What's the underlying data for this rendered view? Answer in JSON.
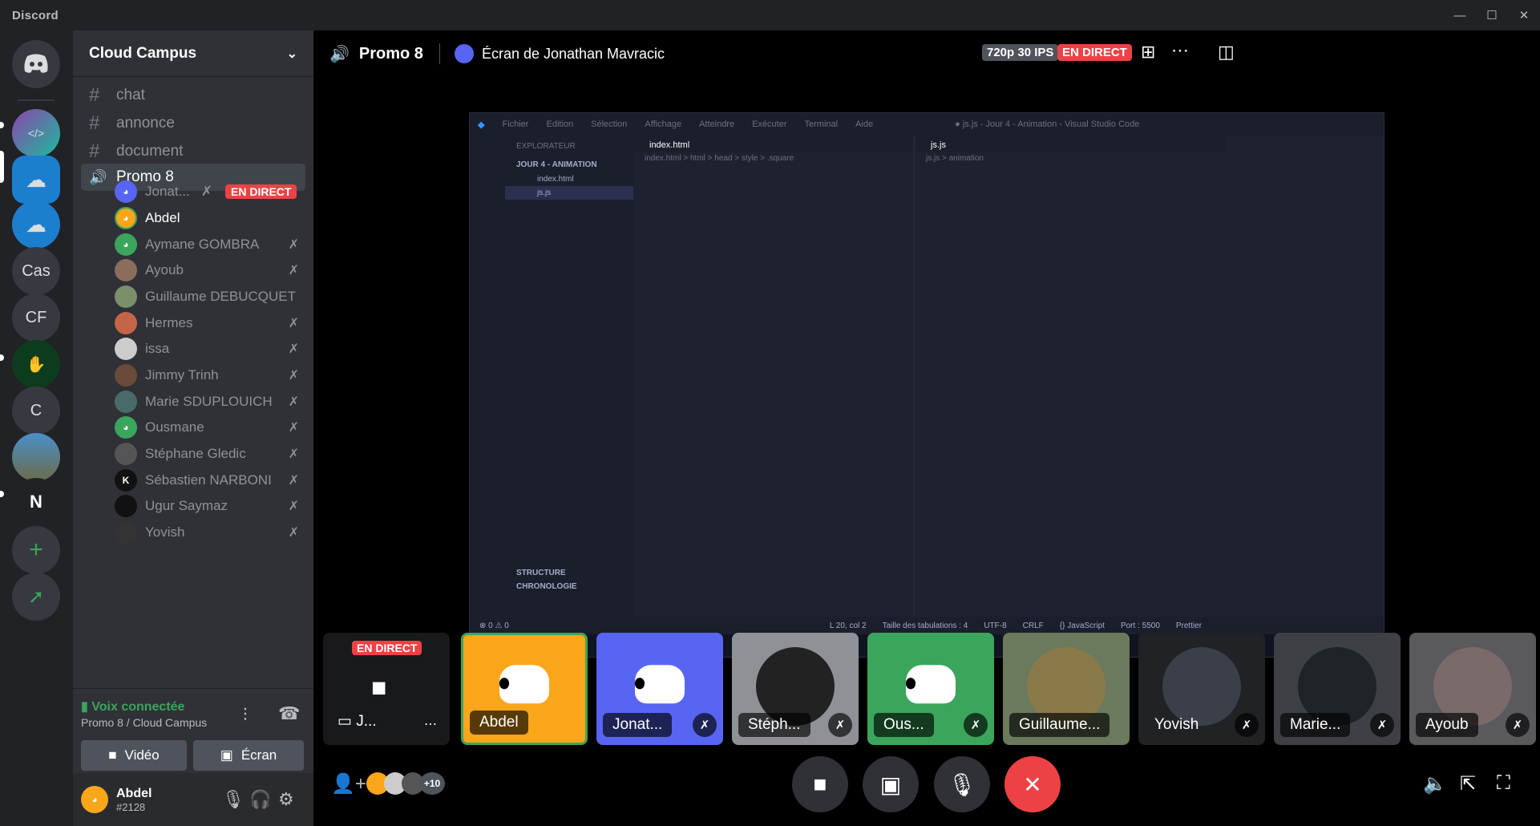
{
  "app": {
    "title": "Discord"
  },
  "colors": {
    "blurple": "#5865f2",
    "green": "#3ba55c",
    "red": "#ed4245",
    "orange": "#faa61a"
  },
  "servers": [
    {
      "label": "Cas"
    },
    {
      "label": "CF"
    },
    {
      "label": "C"
    }
  ],
  "guild": {
    "name": "Cloud Campus"
  },
  "channels": [
    {
      "name": "chat",
      "icon": "hash-icon"
    },
    {
      "name": "annonce",
      "icon": "hash-icon"
    },
    {
      "name": "document",
      "icon": "hash-icon"
    },
    {
      "name": "Promo 8",
      "icon": "speaker-icon"
    }
  ],
  "voice_users": [
    {
      "name": "Jonat...",
      "live": "EN DIRECT"
    },
    {
      "name": "Abdel"
    },
    {
      "name": "Aymane GOMBRA"
    },
    {
      "name": "Ayoub"
    },
    {
      "name": "Guillaume DEBUCQUET"
    },
    {
      "name": "Hermes"
    },
    {
      "name": "issa"
    },
    {
      "name": "Jimmy Trinh"
    },
    {
      "name": "Marie SDUPLOUICH"
    },
    {
      "name": "Ousmane"
    },
    {
      "name": "Stéphane Gledic"
    },
    {
      "name": "Sébastien NARBONI"
    },
    {
      "name": "Ugur Saymaz"
    },
    {
      "name": "Yovish"
    }
  ],
  "voice_panel": {
    "status": "Voix connectée",
    "location": "Promo 8 / Cloud Campus",
    "video": "Vidéo",
    "screen": "Écran"
  },
  "user_panel": {
    "name": "Abdel",
    "tag": "#2128"
  },
  "stream": {
    "channel": "Promo 8",
    "title": "Écran de Jonathan Mavracic",
    "quality": "720p 30 IPS",
    "live": "EN DIRECT"
  },
  "vscode": {
    "menu": [
      "Fichier",
      "Edition",
      "Sélection",
      "Affichage",
      "Atteindre",
      "Exécuter",
      "Terminal",
      "Aide"
    ],
    "window_title": "● js.js - Jour 4 - Animation - Visual Studio Code",
    "explorer": "EXPLORATEUR",
    "folder": "JOUR 4 - ANIMATION",
    "files": [
      "index.html",
      "js.js"
    ],
    "outline": [
      "STRUCTURE",
      "CHRONOLOGIE"
    ],
    "tab_left": "index.html",
    "tab_right": "js.js",
    "breadcrumb_left": "index.html > html > head > style > .square",
    "breadcrumb_right": "js.js > animation",
    "status": [
      "⊗ 0 ⚠ 0",
      "L 20, col 2",
      "Taille des tabulations : 4",
      "UTF-8",
      "CRLF",
      "{} JavaScript",
      "Port : 5500",
      "Prettier"
    ]
  },
  "participants": [
    {
      "name": "J...",
      "live": "EN DIRECT"
    },
    {
      "name": "Abdel"
    },
    {
      "name": "Jonat..."
    },
    {
      "name": "Stéph..."
    },
    {
      "name": "Ous..."
    },
    {
      "name": "Guillaume..."
    },
    {
      "name": "Yovish"
    },
    {
      "name": "Marie..."
    },
    {
      "name": "Ayoub"
    }
  ],
  "footer": {
    "more_count": "+10"
  }
}
